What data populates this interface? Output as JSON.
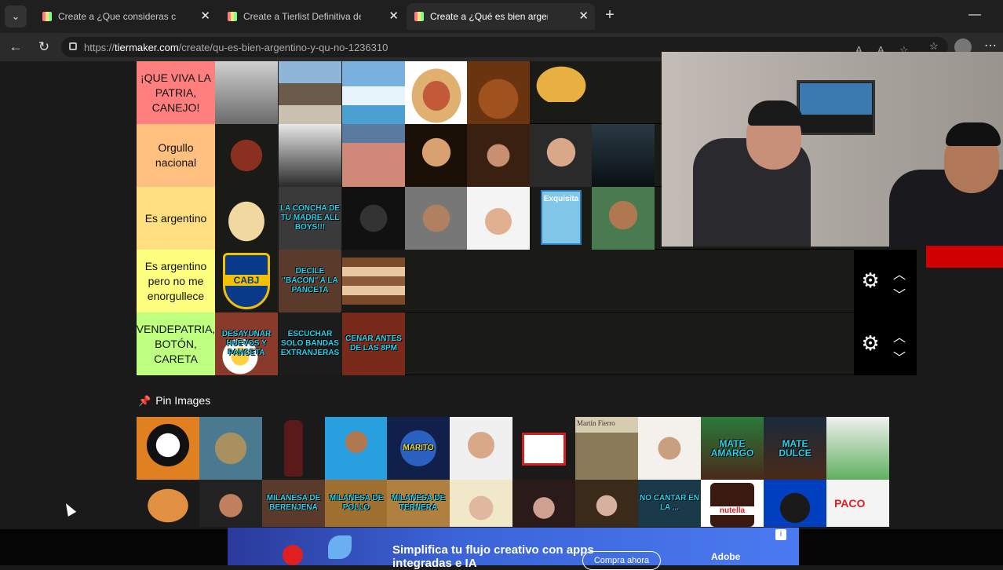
{
  "browser": {
    "tabs": [
      {
        "title": "Create a ¿Que consideras como ir",
        "active": false
      },
      {
        "title": "Create a Tierlist Definitiva de Com",
        "active": false
      },
      {
        "title": "Create a ¿Qué es bien argentino y",
        "active": true
      }
    ],
    "url_prefix": "https://",
    "url_domain": "tiermaker.com",
    "url_path": "/create/qu-es-bien-argentino-y-qu-no-1236310"
  },
  "tiers": [
    {
      "label": "¡QUE VIVA LA PATRIA, CANEJO!",
      "color": "#ff7f7f"
    },
    {
      "label": "Orgullo nacional",
      "color": "#ffbf7f"
    },
    {
      "label": "Es argentino",
      "color": "#ffdf7f"
    },
    {
      "label": "Es argentino pero no me enorgullece",
      "color": "#ffff7f"
    },
    {
      "label": "VENDEPATRIA, BOTÓN, CARETA",
      "color": "#bfff7f"
    }
  ],
  "tier_captions": {
    "row3": [
      "LA CONCHA DE TU MADRE ALL BOYS!!!"
    ],
    "row4": [
      "DECILE \"BACON\" A LA PANCETA"
    ],
    "row5": [
      "DESAYUNAR HUEVOS Y PANCETA",
      "ESCUCHAR SOLO BANDAS EXTRANJERAS",
      "CENAR ANTES DE LAS 8PM"
    ]
  },
  "tier_tile_texts": {
    "cabj": "CABJ",
    "exquisita": "Exquisita"
  },
  "pin_section": {
    "title": "Pin Images",
    "captions": {
      "mate_amargo": "MATE AMARGO",
      "mate_dulce": "MATE DULCE",
      "milanesa_berenjena": "MILANESA DE BERENJENA",
      "milanesa_pollo": "MILANESA DE POLLO",
      "milanesa_ternera": "MILANESA DE TERNERA",
      "no_cantar": "NO CANTAR EN LA ...",
      "martin_fierro": "Martín Fierro",
      "marito": "Marito",
      "nutella": "nutella",
      "paco": "PACO"
    }
  },
  "ad": {
    "text": "Simplifica tu flujo creativo con apps integradas e IA",
    "button": "Compra ahora",
    "brand": "Adobe"
  }
}
